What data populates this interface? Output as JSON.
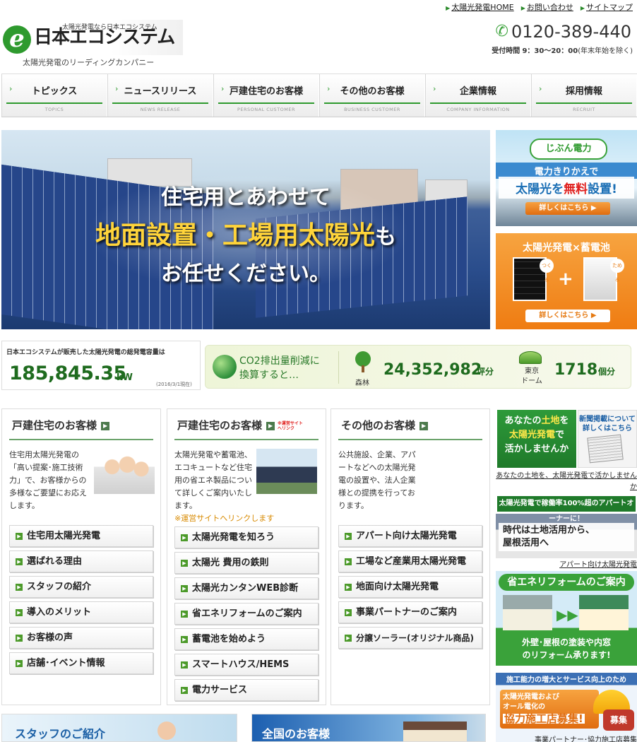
{
  "header": {
    "toplinks": [
      "太陽光発電HOME",
      "お問い合わせ",
      "サイトマップ"
    ],
    "logo_tagline": "太陽光発電なら日本エコシステム",
    "logo_letter": "e",
    "logo_name": "日本エコシステム",
    "logo_sub": "太陽光発電のリーディングカンパニー",
    "phone": "0120-389-440",
    "hours_label": "受付時間",
    "hours_time": "9：30〜20：00",
    "hours_note": "(年末年始を除く)"
  },
  "nav": [
    {
      "label": "トピックス",
      "en": "TOPICS"
    },
    {
      "label": "ニュースリリース",
      "en": "NEWS RELEASE"
    },
    {
      "label": "戸建住宅のお客様",
      "en": "PERSONAL CUSTOMER"
    },
    {
      "label": "その他のお客様",
      "en": "BUSINESS CUSTOMER"
    },
    {
      "label": "企業情報",
      "en": "COMPANY INFORMATION"
    },
    {
      "label": "採用情報",
      "en": "RECRUIT"
    }
  ],
  "hero": {
    "line1": "住宅用とあわせて",
    "line2": "地面設置・工場用太陽光",
    "line2b": "も",
    "line3": "お任せください。"
  },
  "banner_jibun": {
    "logo": "じぶん電力",
    "line1": "電力きりかえで",
    "line2a": "太陽光を",
    "line2b": "無料",
    "line2c": "設置!",
    "button": "詳しくはこちら ▶"
  },
  "banner_battery": {
    "title": "太陽光発電×蓄電池",
    "tag1": "つくる",
    "tag2": "ためる",
    "plus": "+",
    "button": "詳しくはこちら ▶"
  },
  "stats": {
    "caption": "日本エコシステムが販売した太陽光発電の総発電容量は",
    "value": "185,845.35",
    "unit": "kW",
    "date": "(2016/3/1現在)",
    "co2_line1": "CO2排出量削減に",
    "co2_line2": "換算すると…",
    "forest_label": "森林",
    "forest_value": "24,352,982",
    "forest_unit": "坪分",
    "dome_label1": "東京",
    "dome_label2": "ドーム",
    "dome_value": "1718",
    "dome_unit": "個分"
  },
  "columns": [
    {
      "title": "戸建住宅のお客様",
      "desc": "住宅用太陽光発電の「高い提案･施工技術力」で、お客様からの多様なご要望にお応えします。",
      "items": [
        "住宅用太陽光発電",
        "選ばれる理由",
        "スタッフの紹介",
        "導入のメリット",
        "お客様の声",
        "店舗･イベント情報"
      ]
    },
    {
      "title": "戸建住宅のお客様",
      "title_note": "※運営サイトへリンク",
      "desc": "太陽光発電や蓄電池、エコキュートなど住宅用の省エネ製品について詳しくご案内いたします。",
      "note": "※運営サイトへリンクします",
      "items": [
        "太陽光発電を知ろう",
        "太陽光 費用の鉄則",
        "太陽光カンタンWEB診断",
        "省エネリフォームのご案内",
        "蓄電池を始めよう",
        "スマートハウス/HEMS",
        "電力サービス"
      ]
    },
    {
      "title": "その他のお客様",
      "desc": "公共施設、企業、アパートなどへの太陽光発電の設置や、法人企業様との提携を行っております。",
      "items": [
        "アパート向け太陽光発電",
        "工場など産業用太陽光発電",
        "地面向け太陽光発電",
        "事業パートナーのご案内",
        "分譲ソーラー(オリジナル商品)"
      ]
    }
  ],
  "side": {
    "land_a": "あなたの",
    "land_b": "土地",
    "land_c": "を",
    "land_d": "太陽光発電",
    "land_e": "で",
    "land_f": "活かしませんか",
    "paper_title": "新聞掲載について詳しくはこちら",
    "land_caption": "あなたの土地を、太陽光発電で活かしませんか",
    "apt_header": "太陽光発電で稼働率100%超のアパートオーナーに！",
    "apt_body1": "時代は土地活用から、",
    "apt_body2": "屋根活用へ",
    "apt_caption": "アパート向け太陽光発電",
    "reform_title": "省エネリフォームのご案内",
    "reform_arrow": "▶▶",
    "reform_line1": "外壁･屋根の塗装や内窓",
    "reform_line2": "のリフォーム承ります!",
    "partner_header": "施工能力の増大とサービス向上のため",
    "partner_line1": "太陽光発電および",
    "partner_line2": "オール電化の",
    "partner_big": "協力施工店募集!",
    "partner_badge": "募集",
    "partner_caption": "事業パートナー･協力施工店募集"
  },
  "bottom": {
    "staff": "スタッフのご紹介",
    "national": "全国のお客様"
  }
}
